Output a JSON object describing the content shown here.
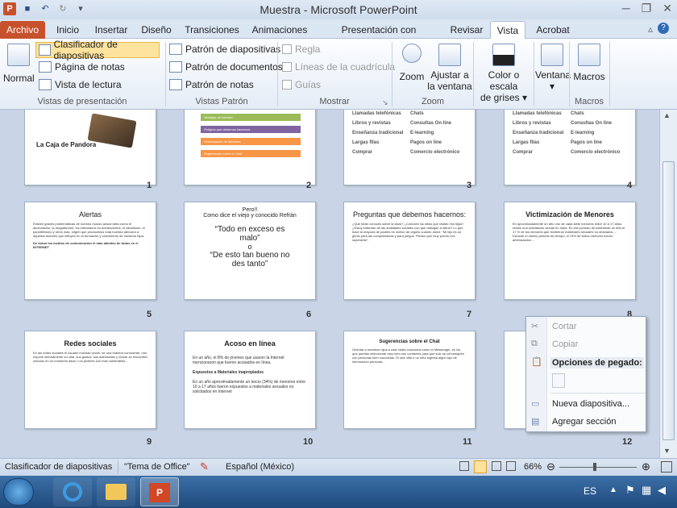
{
  "window": {
    "title": "Muestra  -  Microsoft PowerPoint"
  },
  "tabs": [
    "Inicio",
    "Insertar",
    "Diseño",
    "Transiciones",
    "Animaciones",
    "Presentación con diapositivas",
    "Revisar",
    "Vista",
    "Acrobat"
  ],
  "file_tab": "Archivo",
  "ribbon": {
    "normal": "Normal",
    "slide_sorter": "Clasificador de diapositivas",
    "notes_page": "Página de notas",
    "reading_view": "Vista de lectura",
    "group_presentation_views": "Vistas de presentación",
    "slide_master": "Patrón de diapositivas",
    "handout_master": "Patrón de documentos",
    "notes_master": "Patrón de notas",
    "group_master_views": "Vistas Patrón",
    "ruler": "Regla",
    "gridlines": "Líneas de la cuadrícula",
    "guides": "Guías",
    "group_show": "Mostrar",
    "zoom": "Zoom",
    "fit_window_line1": "Ajustar a",
    "fit_window_line2": "la ventana",
    "group_zoom": "Zoom",
    "color_line1": "Color o escala",
    "color_line2": "de grises",
    "window": "Ventana",
    "macros": "Macros",
    "group_macros": "Macros"
  },
  "slides": {
    "s1_title": "La Caja de Pandora",
    "s2_items": [
      "Ventajas de Internet",
      "Peligros que debemos hacernos",
      "Victimización de Menores",
      "Sugerencias sobre el Chat"
    ],
    "s3_rows": [
      [
        "Llamadas telefónicas",
        "Chats"
      ],
      [
        "Libros y revistas",
        "Consultas On line"
      ],
      [
        "Enseñanza tradicional",
        "E-learning"
      ],
      [
        "Largas filas",
        "Pagos on line"
      ],
      [
        "Comprar",
        "Comercio electrónico"
      ]
    ],
    "s5_title": "Alertas",
    "s5_body": "Existen graves problemáticas de nuestro mundo actual tales como el alcoholismo, la drogadicción, los embarazos en adolescentes, el satanismo, el pandillerismo y otros más, origen que producimos toda nuestra atención a aquellos factores que influyen en la formación y crecimiento de nuestros hijos.",
    "s5_body2": "De todos los medios de comunicación el más adictivo de todos es el INTERNET",
    "s6_title": "Pero!!\nComo dice el viejo y conocido Refrán",
    "s6_q1": "“Todo en exceso es malo”",
    "s6_or": "o",
    "s6_q2": "“De esto tan bueno no des tanto”",
    "s7_title": "Preguntas que debemos hacernos:",
    "s7_body": "¿Qué tanto conoces sobre la www? ¿Conoces los sitios que visitan mis hijos? ¿Estoy enterado de las amistades sociales con que dialogan a diario? Lo que hace la mayoría de padres es motivo de orgullo cuando dicen: “Mi hijo es un genio para las computadoras y para juegos. Pienso que muy pronto nos superarán”.",
    "s8_title": "Victimización de Menores",
    "s8_body": "En aproximadamente un año uno de cada siete menores entre 10 a 17 años recibe una solicitación sexual en línea. En ese periodo de solamente un año el 17 % de los menores que recibieron materiales sexuales no deseados ... Durante el mismo periodo de tiempo, el 13% de todos menores fueron amenazados ...",
    "s9_title": "Redes sociales",
    "s9_body": "En las redes sociales el usuario muchas veces, de una manera consciente, nos expone directamente su vida, sus gustos, sus actividades y dónde se encuentra ubicado en un momento dado. Los jóvenes son más vulnerables...",
    "s10_title": "Acoso en línea",
    "s10_body1": "En un año, el 8% de jóvenes que usaron la Internet mencionaron que fueron acosados en línea.",
    "s10_body2": "Expuestos a Materiales inapropiados",
    "s10_body3": "En un año aproximadamente un tercio (34%) de menores entre 10 a 17 años fueron expuestos a materiales sexuales no solicitados en Internet",
    "s11_title": "Sugerencias sobre el Chat",
    "s11_body": "Orientar a nuestros hijos a usar chats conocidos como el Messenger, en los que puedan seleccionar muy bien sus contactos para que solo se comuniquen con personas bien conocidas. Si una niña o un niño ingresa algún tipo de información personal...",
    "numbers": [
      "1",
      "2",
      "3",
      "4",
      "5",
      "6",
      "7",
      "8",
      "9",
      "10",
      "11",
      "12"
    ]
  },
  "context_menu": {
    "cut": "Cortar",
    "copy": "Copiar",
    "paste_options": "Opciones de pegado:",
    "new_slide": "Nueva diapositiva...",
    "add_section": "Agregar sección"
  },
  "status": {
    "view": "Clasificador de diapositivas",
    "theme": "\"Tema de Office\"",
    "language": "Español (México)",
    "zoom": "66%"
  },
  "taskbar": {
    "language": "ES"
  },
  "colors": {
    "accent": "#c6512c",
    "bar_green": "#9bbb59",
    "bar_purple": "#8064a2",
    "bar_orange": "#f79646"
  }
}
